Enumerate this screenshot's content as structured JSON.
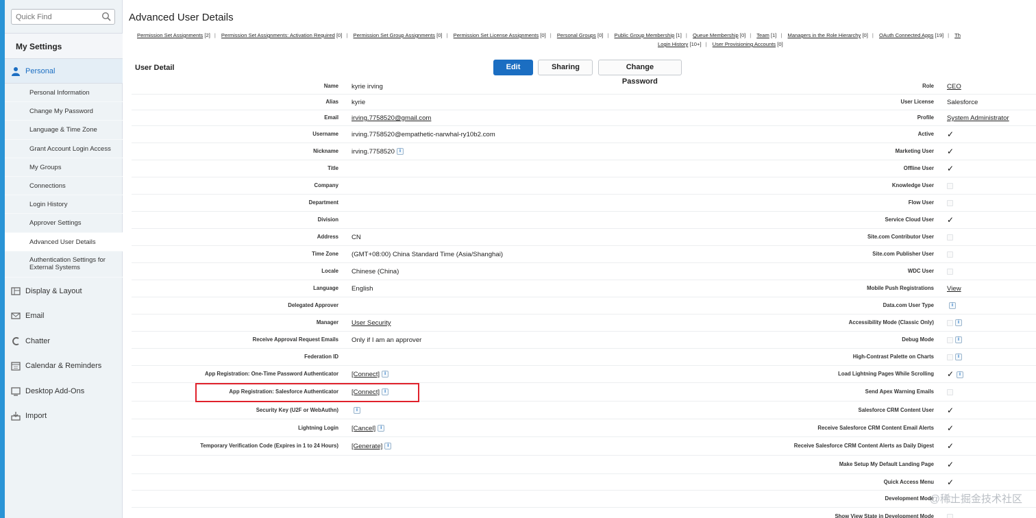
{
  "sidebar": {
    "quick_find_placeholder": "Quick Find",
    "my_settings": "My Settings",
    "personal": "Personal",
    "personal_items": [
      "Personal Information",
      "Change My Password",
      "Language & Time Zone",
      "Grant Account Login Access",
      "My Groups",
      "Connections",
      "Login History",
      "Approver Settings",
      "Advanced User Details",
      "Authentication Settings for External Systems"
    ],
    "sections": [
      "Display & Layout",
      "Email",
      "Chatter",
      "Calendar & Reminders",
      "Desktop Add-Ons",
      "Import"
    ]
  },
  "page_title": "Advanced User Details",
  "related_links": [
    {
      "label": "Permission Set Assignments",
      "count": "[2]"
    },
    {
      "label": "Permission Set Assignments: Activation Required",
      "count": "[0]"
    },
    {
      "label": "Permission Set Group Assignments",
      "count": "[0]"
    },
    {
      "label": "Permission Set License Assignments",
      "count": "[0]"
    },
    {
      "label": "Personal Groups",
      "count": "[0]"
    },
    {
      "label": "Public Group Membership",
      "count": "[1]"
    },
    {
      "label": "Queue Membership",
      "count": "[0]"
    },
    {
      "label": "Team",
      "count": "[1]"
    },
    {
      "label": "Managers in the Role Hierarchy",
      "count": "[0]"
    },
    {
      "label": "OAuth Connected Apps",
      "count": "[19]"
    },
    {
      "label": "Th",
      "count": ""
    },
    {
      "label": "Login History",
      "count": "[10+]"
    },
    {
      "label": "User Provisioning Accounts",
      "count": "[0]"
    }
  ],
  "detail": {
    "title": "User Detail",
    "buttons": {
      "edit": "Edit",
      "sharing": "Sharing",
      "change_password": "Change Password"
    },
    "left": [
      {
        "label": "Name",
        "value": "kyrie irving"
      },
      {
        "label": "Alias",
        "value": "kyrie"
      },
      {
        "label": "Email",
        "value": "irving.7758520@gmail.com"
      },
      {
        "label": "Username",
        "value": "irving.7758520@empathetic-narwhal-ry10b2.com"
      },
      {
        "label": "Nickname",
        "value": "irving.7758520"
      },
      {
        "label": "Title",
        "value": ""
      },
      {
        "label": "Company",
        "value": ""
      },
      {
        "label": "Department",
        "value": ""
      },
      {
        "label": "Division",
        "value": ""
      },
      {
        "label": "Address",
        "value": "CN"
      },
      {
        "label": "Time Zone",
        "value": "(GMT+08:00) China Standard Time (Asia/Shanghai)"
      },
      {
        "label": "Locale",
        "value": "Chinese (China)"
      },
      {
        "label": "Language",
        "value": "English"
      },
      {
        "label": "Delegated Approver",
        "value": ""
      },
      {
        "label": "Manager",
        "value": "User Security"
      },
      {
        "label": "Receive Approval Request Emails",
        "value": "Only if I am an approver"
      },
      {
        "label": "Federation ID",
        "value": ""
      },
      {
        "label": "App Registration: One-Time Password Authenticator",
        "value": "[Connect]"
      },
      {
        "label": "App Registration: Salesforce Authenticator",
        "value": "[Connect]"
      },
      {
        "label": "Security Key (U2F or WebAuthn)",
        "value": ""
      },
      {
        "label": "Lightning Login",
        "value": "[Cancel]"
      },
      {
        "label": "Temporary Verification Code (Expires in 1 to 24 Hours)",
        "value": "[Generate]"
      }
    ],
    "right": [
      {
        "label": "Role",
        "value": "CEO"
      },
      {
        "label": "User License",
        "value": "Salesforce"
      },
      {
        "label": "Profile",
        "value": "System Administrator"
      },
      {
        "label": "Active",
        "value": "✓"
      },
      {
        "label": "Marketing User",
        "value": "✓"
      },
      {
        "label": "Offline User",
        "value": "✓"
      },
      {
        "label": "Knowledge User",
        "value": ""
      },
      {
        "label": "Flow User",
        "value": ""
      },
      {
        "label": "Service Cloud User",
        "value": "✓"
      },
      {
        "label": "Site.com Contributor User",
        "value": ""
      },
      {
        "label": "Site.com Publisher User",
        "value": ""
      },
      {
        "label": "WDC User",
        "value": ""
      },
      {
        "label": "Mobile Push Registrations",
        "value": "View"
      },
      {
        "label": "Data.com User Type",
        "value": ""
      },
      {
        "label": "Accessibility Mode (Classic Only)",
        "value": ""
      },
      {
        "label": "Debug Mode",
        "value": ""
      },
      {
        "label": "High-Contrast Palette on Charts",
        "value": ""
      },
      {
        "label": "Load Lightning Pages While Scrolling",
        "value": "✓"
      },
      {
        "label": "Send Apex Warning Emails",
        "value": ""
      },
      {
        "label": "Salesforce CRM Content User",
        "value": "✓"
      },
      {
        "label": "Receive Salesforce CRM Content Email Alerts",
        "value": "✓"
      },
      {
        "label": "Receive Salesforce CRM Content Alerts as Daily Digest",
        "value": "✓"
      },
      {
        "label": "Make Setup My Default Landing Page",
        "value": "✓"
      },
      {
        "label": "Quick Access Menu",
        "value": "✓"
      },
      {
        "label": "Development Mode",
        "value": ""
      },
      {
        "label": "Show View State in Development Mode",
        "value": ""
      }
    ]
  },
  "info_glyph": "i",
  "watermark": "@稀土掘金技术社区",
  "colors": {
    "accent": "#1b6ec2",
    "sidebar_edge": "#2a94d6",
    "highlight": "#e0202a"
  }
}
